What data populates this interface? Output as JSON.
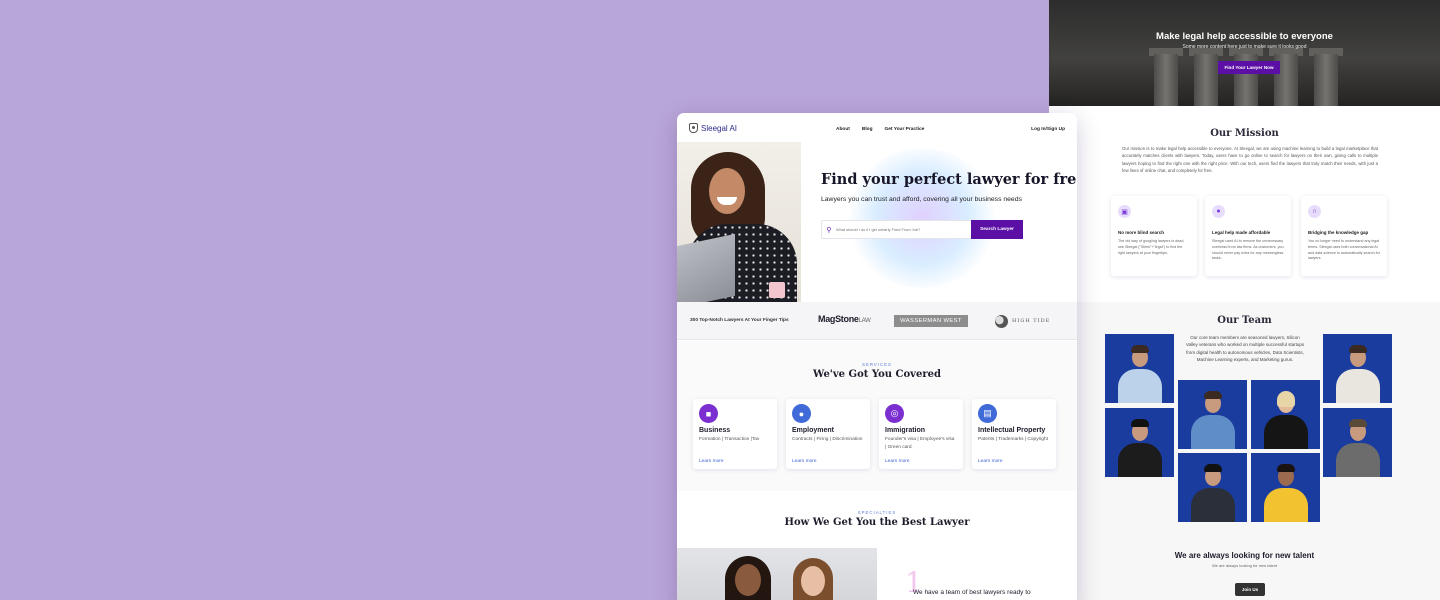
{
  "right_page": {
    "hero": {
      "title": "Make legal help accessible to everyone",
      "subtitle": "Some more content here just to make sure it looks good",
      "button": "Find Your Lawyer Now"
    },
    "mission": {
      "title": "Our Mission",
      "text": "Our mission is to make legal help accessible to everyone. At Sleegal, we are using machine learning to build a legal marketplace that accurately matches clients with lawyers. Today, users have to go online to search for lawyers on their own, giving calls to multiple lawyers hoping to find the right one with the right price. With our tech, users find the lawyers that truly match their needs, with just a few lines of online chat, and completely for free.",
      "cards": [
        {
          "icon": "search-icon",
          "title": "No more blind search",
          "text": "The old way of googling lawyers is dead, use Sleegal (\"Sleek\"+\"legal\") to find the right lawyers at your fingertips."
        },
        {
          "icon": "money-icon",
          "title": "Legal help made affordable",
          "text": "Sleegal used AI to remove the unnecessary overhead from law firms. As customers, you should never pay extra for any meaningless tasks."
        },
        {
          "icon": "bridge-icon",
          "title": "Bridging the knowledge gap",
          "text": "You no longer need to understand any legal terms. Sleegal uses both conversational AI and data science to automatically search for lawyers."
        }
      ]
    },
    "team": {
      "title": "Our Team",
      "text": "Our core team members are seasoned lawyers, Silicon Valley veterans who worked on multiple successful startups from digital health to autonomous vehicles, Data Scientists, Machine Learning experts, and Marketing gurus."
    },
    "hiring": {
      "title": "We are always looking for new talent",
      "subtitle": "We are always looking for new talent",
      "button": "Join Us"
    }
  },
  "main_page": {
    "logo": "Sleegal AI",
    "nav": [
      "About",
      "Blog",
      "Get Your Practice"
    ],
    "login": "Log In/Sign Up",
    "hero": {
      "title": "Find your perfect lawyer for free",
      "subtitle": "Lawyers you can trust and afford, covering all your business needs",
      "search_placeholder": "What should I do if I get unfairly Fired From Job?",
      "search_button": "Search Lawyer"
    },
    "strip": {
      "label": "300 Top-Notch Lawyers At Your Finger Tips",
      "logos": {
        "magstone": "MagStone",
        "magstone_suffix": "LAW",
        "wasserman": "WASSERMAN WEST",
        "hightide": "HIGH TIDE"
      }
    },
    "services": {
      "kicker": "SERVICES",
      "title": "We've Got You Covered",
      "cards": [
        {
          "icon": "briefcase-icon",
          "color": "#7b2fd1",
          "title": "Business",
          "text": "Formation | Transaction |Tax",
          "link": "Learn more"
        },
        {
          "icon": "employee-icon",
          "color": "#3f6ad8",
          "title": "Employment",
          "text": "Contracts | Firing | Discrimination",
          "link": "Learn more"
        },
        {
          "icon": "passport-icon",
          "color": "#7b2fd1",
          "title": "Immigration",
          "text": "Founder's visa | Employee's visa | Green card",
          "link": "Learn more"
        },
        {
          "icon": "certificate-icon",
          "color": "#3f6ad8",
          "title": "Intellectual Property",
          "text": "Patents | Trademarks | Copyright",
          "link": "Learn more"
        }
      ]
    },
    "specialties": {
      "kicker": "SPECIALTIES",
      "title": "How We Get You the Best Lawyer",
      "step_number": "1",
      "step_text": "We have a team of best lawyers ready to"
    }
  }
}
